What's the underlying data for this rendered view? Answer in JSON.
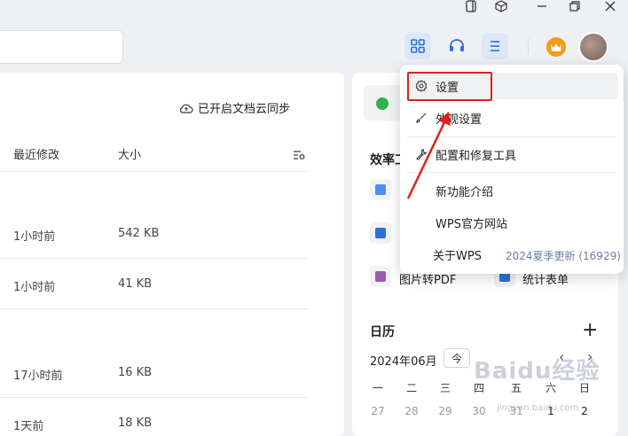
{
  "titlebar": {
    "icons": [
      "window-icon",
      "cube-icon",
      "minimize-icon",
      "restore-icon",
      "close-icon"
    ]
  },
  "toolbar": {
    "search_placeholder": "",
    "icons": [
      "grid-icon",
      "headset-icon",
      "menu-icon",
      "crown-icon",
      "avatar"
    ]
  },
  "files": {
    "cloud_sync_label": "已开启文档云同步",
    "columns": {
      "modified": "最近修改",
      "size": "大小"
    },
    "rows": [
      {
        "modified": "1小时前",
        "size": "542 KB"
      },
      {
        "modified": "1小时前",
        "size": "41 KB"
      },
      {
        "modified": "17小时前",
        "size": "16 KB"
      },
      {
        "modified": "1天前",
        "size": "18 KB"
      }
    ]
  },
  "right_panel": {
    "tools_title": "效率工",
    "tools": [
      {
        "label": "图片转PDF",
        "color": "#9b59b6"
      },
      {
        "label": "统计表单",
        "color": "#2f6fd6"
      }
    ],
    "calendar": {
      "title": "日历",
      "add": "+",
      "month": "2024年06月",
      "today_btn": "今",
      "prev": "‹",
      "next": "›",
      "weekdays": [
        "一",
        "二",
        "三",
        "四",
        "五",
        "六",
        "日"
      ],
      "days": [
        "27",
        "28",
        "29",
        "30",
        "31",
        "1",
        "2"
      ]
    }
  },
  "menu": {
    "items": [
      {
        "label": "设置",
        "icon": "gear-icon"
      },
      {
        "label": "外观设置",
        "icon": "brush-icon"
      },
      {
        "label": "配置和修复工具",
        "icon": "wrench-icon"
      },
      {
        "label": "新功能介绍",
        "icon": ""
      },
      {
        "label": "WPS官方网站",
        "icon": ""
      },
      {
        "label": "关于WPS",
        "icon": ""
      }
    ],
    "version": "2024夏季更新 (16929)"
  },
  "watermark": {
    "text": "Baidu经验",
    "sub": "jingyan.baidu.com"
  },
  "colors": {
    "accent": "#2f6fd6",
    "highlight": "#e0201b",
    "active_bg": "#dde6fb"
  }
}
